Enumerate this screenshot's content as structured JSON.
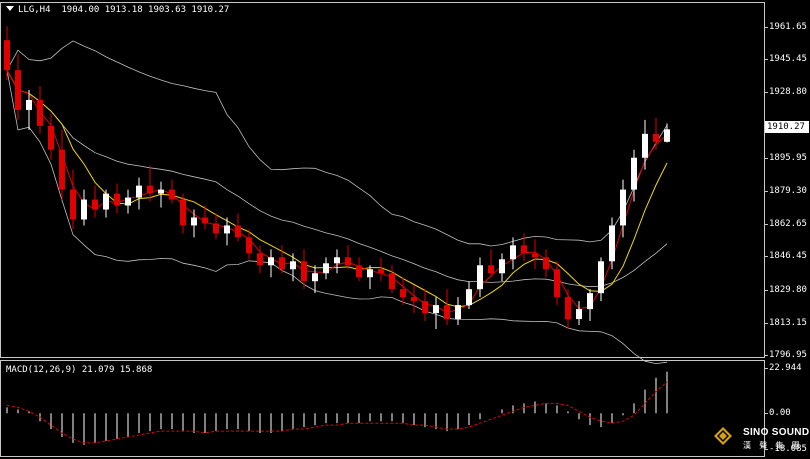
{
  "header": {
    "symbol_timeframe": "LLG,H4",
    "ohlc": "1904.00 1913.18 1903.63 1910.27"
  },
  "price_axis": {
    "ticks": [
      "1961.65",
      "1945.45",
      "1928.80",
      "1912.15",
      "1895.95",
      "1879.30",
      "1862.65",
      "1846.45",
      "1829.80",
      "1813.15",
      "1796.95"
    ]
  },
  "current_price": "1910.27",
  "macd": {
    "label": "MACD(12,26,9) 21.079 15.868",
    "axis_ticks": [
      "22.944",
      "0.00",
      "-18.085"
    ]
  },
  "logo": {
    "name": "SINO SOUND",
    "sub": "漢 聲 集 團"
  },
  "colors": {
    "bull": "#ffffff",
    "bear": "#e00000",
    "bollinger": "#bfbfbf",
    "ma": "#f2d600",
    "signal": "#e00000",
    "macd_hist": "#ffffff"
  },
  "chart_data": {
    "type": "candlestick",
    "ylim": [
      1796.95,
      1961.65
    ],
    "macd_ylim": [
      -18.085,
      22.944
    ],
    "series": [
      {
        "name": "ohlc",
        "values": [
          [
            1955,
            1962,
            1935,
            1940
          ],
          [
            1940,
            1948,
            1915,
            1920
          ],
          [
            1920,
            1930,
            1910,
            1925
          ],
          [
            1925,
            1932,
            1908,
            1912
          ],
          [
            1912,
            1918,
            1895,
            1900
          ],
          [
            1900,
            1910,
            1875,
            1880
          ],
          [
            1880,
            1890,
            1860,
            1865
          ],
          [
            1865,
            1880,
            1862,
            1875
          ],
          [
            1875,
            1882,
            1866,
            1870
          ],
          [
            1870,
            1880,
            1866,
            1878
          ],
          [
            1878,
            1883,
            1868,
            1872
          ],
          [
            1872,
            1880,
            1868,
            1876
          ],
          [
            1876,
            1886,
            1870,
            1882
          ],
          [
            1882,
            1892,
            1874,
            1878
          ],
          [
            1878,
            1884,
            1871,
            1880
          ],
          [
            1880,
            1885,
            1873,
            1875
          ],
          [
            1875,
            1878,
            1858,
            1862
          ],
          [
            1862,
            1870,
            1856,
            1866
          ],
          [
            1866,
            1872,
            1860,
            1863
          ],
          [
            1863,
            1868,
            1855,
            1858
          ],
          [
            1858,
            1866,
            1852,
            1862
          ],
          [
            1862,
            1868,
            1854,
            1856
          ],
          [
            1856,
            1860,
            1845,
            1848
          ],
          [
            1848,
            1852,
            1838,
            1842
          ],
          [
            1842,
            1850,
            1836,
            1846
          ],
          [
            1846,
            1852,
            1838,
            1840
          ],
          [
            1840,
            1848,
            1834,
            1844
          ],
          [
            1844,
            1850,
            1830,
            1834
          ],
          [
            1834,
            1842,
            1828,
            1838
          ],
          [
            1838,
            1846,
            1835,
            1843
          ],
          [
            1843,
            1850,
            1838,
            1846
          ],
          [
            1846,
            1852,
            1840,
            1842
          ],
          [
            1842,
            1846,
            1834,
            1836
          ],
          [
            1836,
            1842,
            1830,
            1840
          ],
          [
            1840,
            1846,
            1834,
            1838
          ],
          [
            1838,
            1842,
            1828,
            1830
          ],
          [
            1830,
            1836,
            1822,
            1826
          ],
          [
            1826,
            1832,
            1818,
            1824
          ],
          [
            1824,
            1830,
            1814,
            1818
          ],
          [
            1818,
            1826,
            1810,
            1822
          ],
          [
            1822,
            1830,
            1812,
            1815
          ],
          [
            1815,
            1826,
            1812,
            1822
          ],
          [
            1822,
            1834,
            1820,
            1830
          ],
          [
            1830,
            1846,
            1826,
            1842
          ],
          [
            1842,
            1850,
            1836,
            1838
          ],
          [
            1838,
            1848,
            1834,
            1845
          ],
          [
            1845,
            1856,
            1840,
            1852
          ],
          [
            1852,
            1858,
            1844,
            1848
          ],
          [
            1848,
            1855,
            1840,
            1846
          ],
          [
            1846,
            1850,
            1836,
            1840
          ],
          [
            1840,
            1844,
            1822,
            1826
          ],
          [
            1826,
            1830,
            1810,
            1815
          ],
          [
            1815,
            1824,
            1812,
            1820
          ],
          [
            1820,
            1830,
            1814,
            1828
          ],
          [
            1828,
            1846,
            1824,
            1844
          ],
          [
            1844,
            1866,
            1840,
            1862
          ],
          [
            1862,
            1885,
            1856,
            1880
          ],
          [
            1880,
            1900,
            1874,
            1896
          ],
          [
            1896,
            1915,
            1890,
            1908
          ],
          [
            1908,
            1916,
            1900,
            1904
          ],
          [
            1904,
            1913.18,
            1903.63,
            1910.27
          ]
        ]
      },
      {
        "name": "macd_hist",
        "values": [
          3,
          2,
          1,
          -4,
          -8,
          -12,
          -15,
          -16,
          -15,
          -14,
          -13,
          -12,
          -10,
          -9,
          -8,
          -8,
          -9,
          -10,
          -10,
          -9,
          -8,
          -8,
          -9,
          -10,
          -10,
          -9,
          -8,
          -7,
          -6,
          -5,
          -5,
          -5,
          -5,
          -4,
          -4,
          -4,
          -5,
          -6,
          -7,
          -8,
          -9,
          -8,
          -6,
          -3,
          0,
          2,
          4,
          5,
          6,
          5,
          4,
          1,
          -3,
          -6,
          -7,
          -5,
          -1,
          5,
          12,
          18,
          21.079
        ]
      },
      {
        "name": "signal",
        "values": [
          4,
          3,
          1,
          -2,
          -6,
          -10,
          -13,
          -15,
          -15,
          -14,
          -13,
          -12,
          -11,
          -10,
          -9,
          -9,
          -9,
          -9,
          -10,
          -9,
          -9,
          -9,
          -9,
          -9,
          -9,
          -9,
          -8,
          -8,
          -7,
          -6,
          -6,
          -5,
          -5,
          -5,
          -5,
          -5,
          -5,
          -6,
          -6,
          -7,
          -8,
          -8,
          -7,
          -5,
          -3,
          -1,
          1,
          3,
          4,
          5,
          5,
          4,
          1,
          -2,
          -4,
          -5,
          -4,
          -1,
          5,
          11,
          15.868
        ]
      }
    ]
  }
}
